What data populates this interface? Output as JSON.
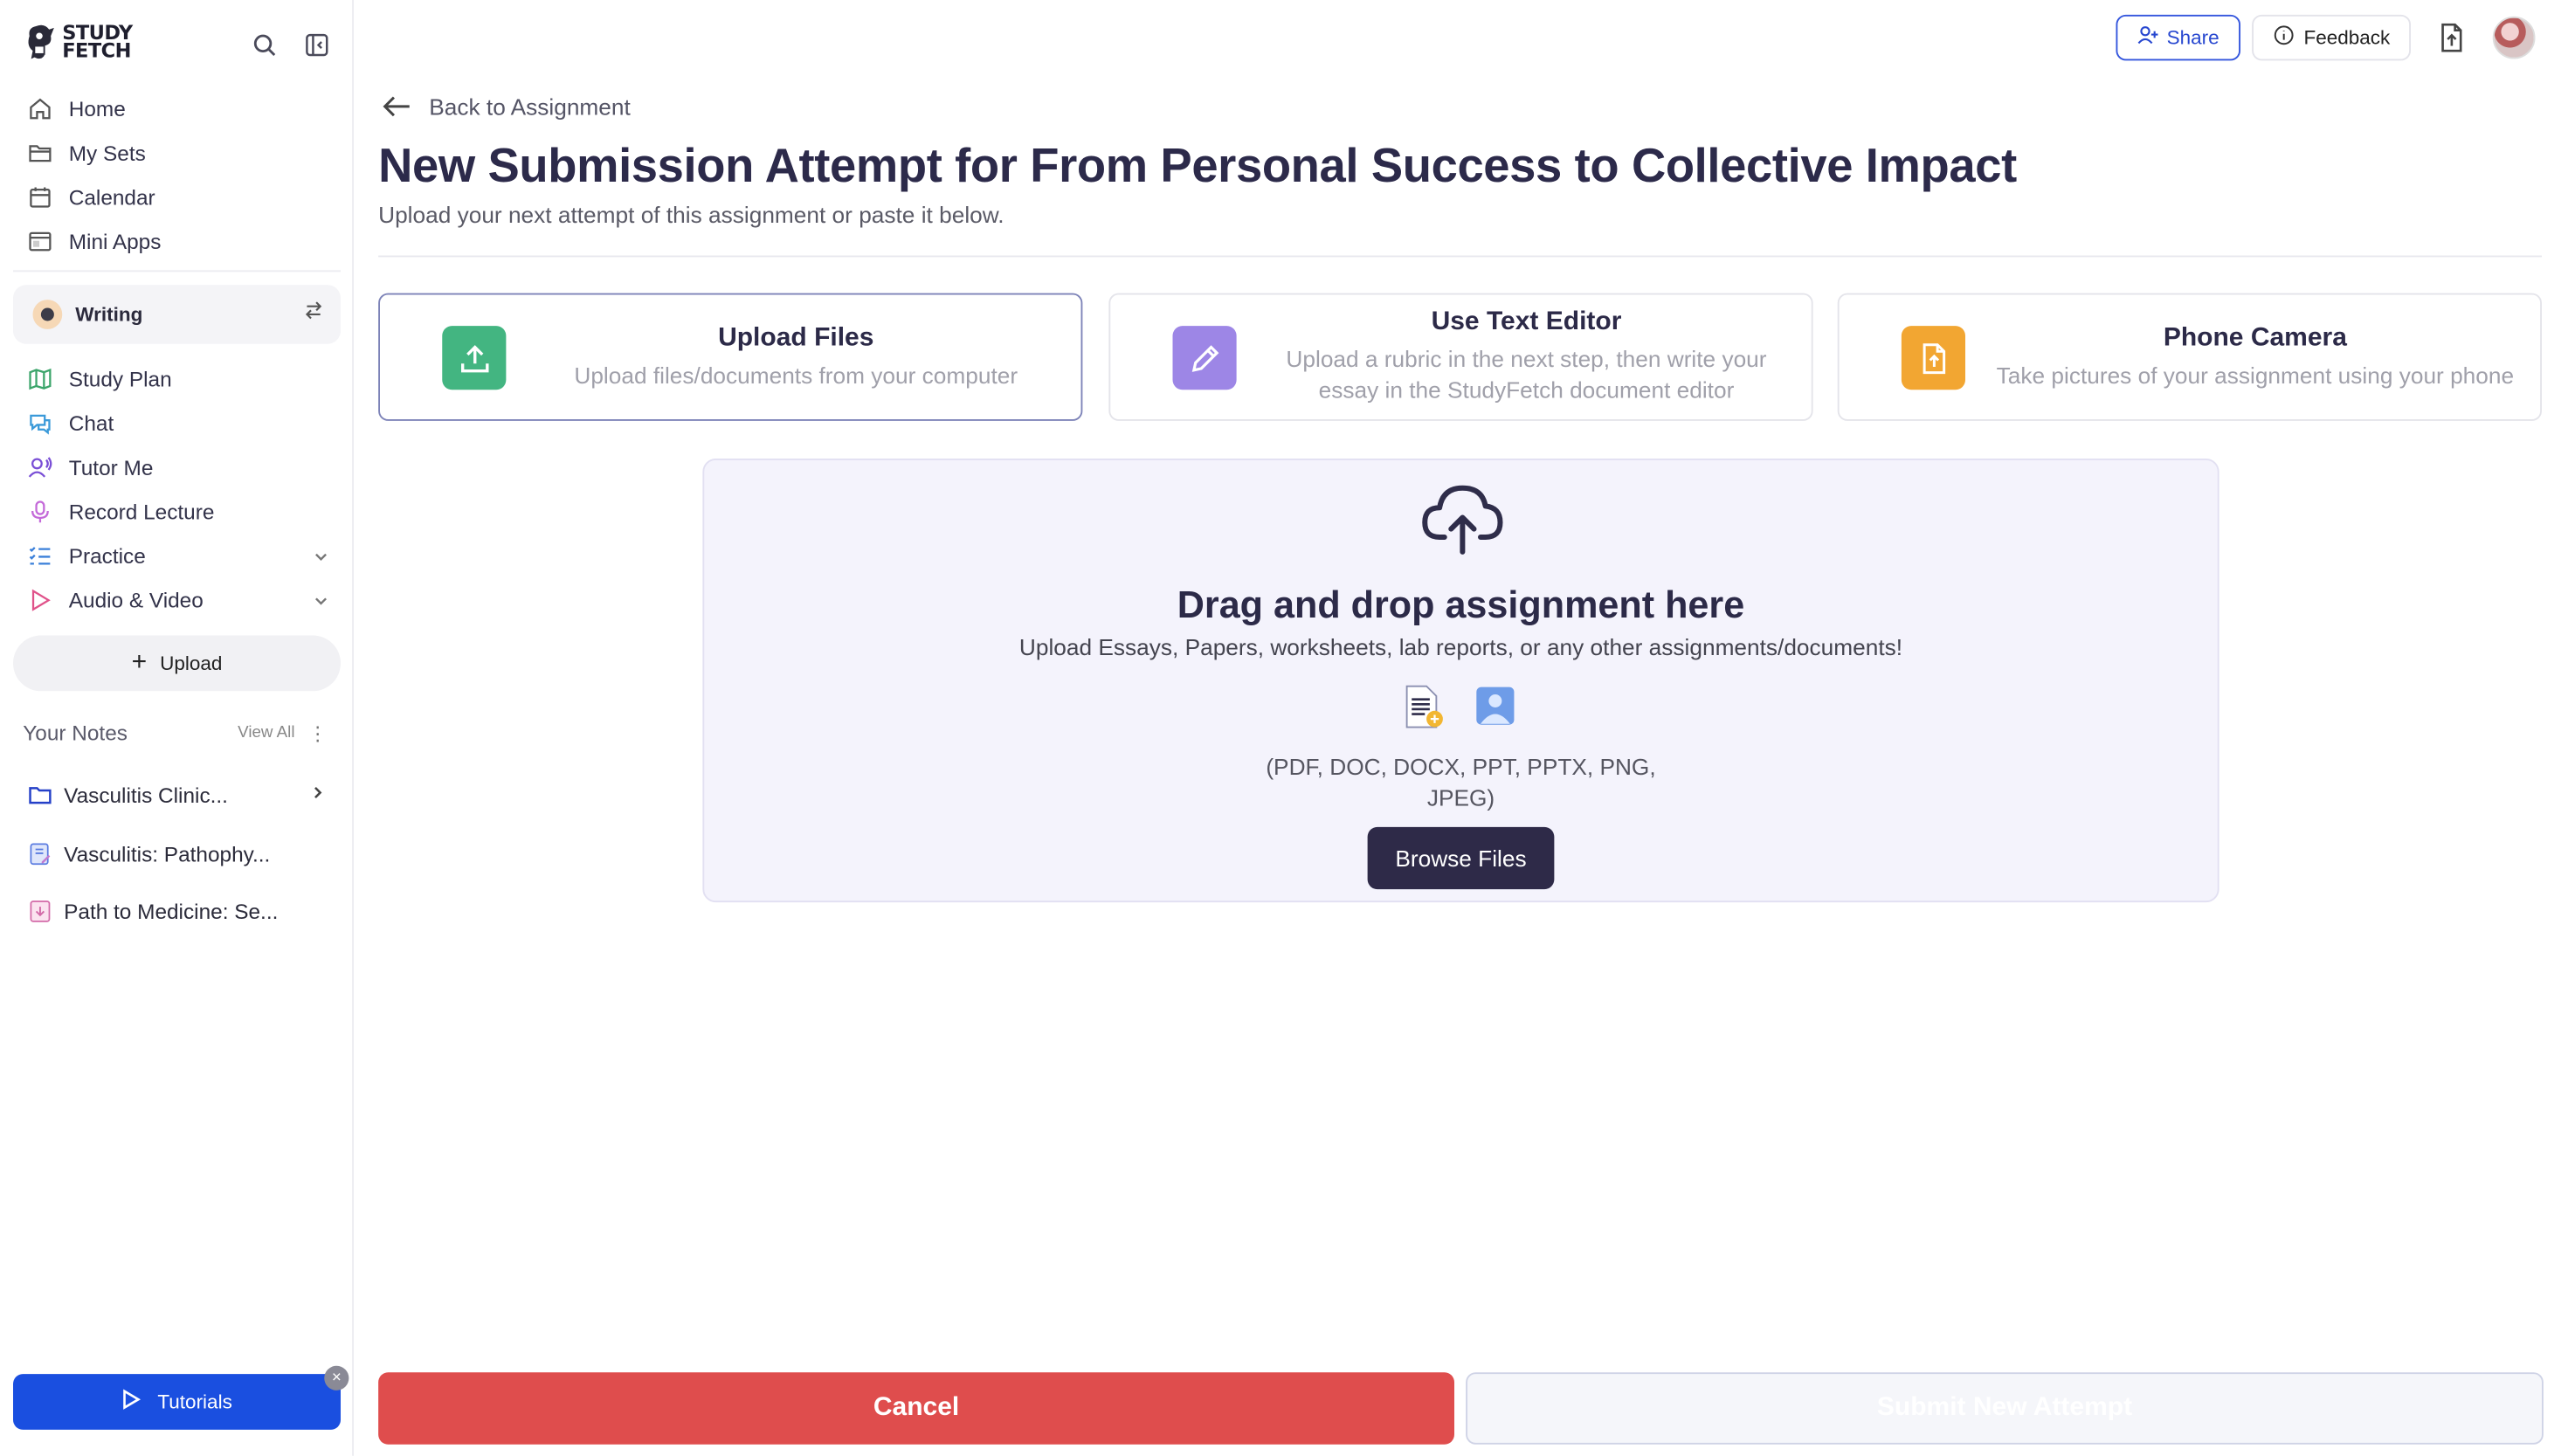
{
  "app": {
    "logo_text_line1": "STUDY",
    "logo_text_line2": "FETCH"
  },
  "sidebar": {
    "nav_top": [
      {
        "label": "Home",
        "icon": "home-icon"
      },
      {
        "label": "My Sets",
        "icon": "folder-icon"
      },
      {
        "label": "Calendar",
        "icon": "calendar-icon"
      },
      {
        "label": "Mini Apps",
        "icon": "apps-icon"
      }
    ],
    "writing_label": "Writing",
    "nav_tools": [
      {
        "label": "Study Plan",
        "icon": "map-icon",
        "color": "#3ca56b"
      },
      {
        "label": "Chat",
        "icon": "chat-icon",
        "color": "#3a9ad9"
      },
      {
        "label": "Tutor Me",
        "icon": "tutor-icon",
        "color": "#7a4fd6"
      },
      {
        "label": "Record Lecture",
        "icon": "microphone-icon",
        "color": "#c46ad9"
      },
      {
        "label": "Practice",
        "icon": "list-check-icon",
        "color": "#3a7fd9"
      },
      {
        "label": "Audio & Video",
        "icon": "play-icon",
        "color": "#e0528a"
      }
    ],
    "upload_label": "Upload",
    "notes_title": "Your Notes",
    "view_all": "View All",
    "notes": [
      {
        "label": "Vasculitis Clinic...",
        "icon": "folder-icon"
      },
      {
        "label": "Vasculitis: Pathophy...",
        "icon": "note-edit-icon"
      },
      {
        "label": "Path to Medicine: Se...",
        "icon": "note-download-icon"
      }
    ],
    "tutorials_label": "Tutorials"
  },
  "topbar": {
    "share_label": "Share",
    "feedback_label": "Feedback"
  },
  "main": {
    "back_label": "Back to Assignment",
    "title": "New Submission Attempt for From Personal Success to Collective Impact",
    "subtitle": "Upload your next attempt of this assignment or paste it below.",
    "options": [
      {
        "title": "Upload Files",
        "desc": "Upload files/documents from your computer",
        "color": "#43b581",
        "selected": true
      },
      {
        "title": "Use Text Editor",
        "desc": "Upload a rubric in the next step, then write your essay in the StudyFetch document editor",
        "color": "#9d86e6",
        "selected": false
      },
      {
        "title": "Phone Camera",
        "desc": "Take pictures of your assignment using your phone",
        "color": "#f2a632",
        "selected": false
      }
    ],
    "dropzone": {
      "title": "Drag and drop assignment here",
      "subtitle": "Upload Essays, Papers, worksheets, lab reports, or any other assignments/documents!",
      "formats": "(PDF, DOC, DOCX, PPT, PPTX, PNG, JPEG)",
      "browse_label": "Browse Files"
    },
    "cancel_label": "Cancel",
    "submit_label": "Submit New Attempt"
  }
}
